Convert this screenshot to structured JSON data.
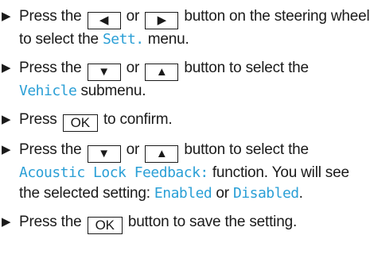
{
  "steps": [
    {
      "a": "Press the",
      "key1": "◀",
      "b": "or",
      "key2": "▶",
      "c": "button on the steering wheel to select the",
      "disp": "Sett.",
      "d": "menu."
    },
    {
      "a": "Press the",
      "key1": "▼",
      "b": "or",
      "key2": "▲",
      "c": "button to select the",
      "disp": "Vehicle",
      "d": "submenu."
    },
    {
      "a": "Press",
      "key": "OK",
      "b": "to confirm."
    },
    {
      "a": "Press the",
      "key1": "▼",
      "b": "or",
      "key2": "▲",
      "c": "button to select the",
      "disp": "Acoustic Lock Feedback:",
      "d": "function. You will see the selected setting:",
      "disp2": "Enabled",
      "e": "or",
      "disp3": "Disabled",
      "f": "."
    },
    {
      "a": "Press the",
      "key": "OK",
      "b": "button to save the setting."
    }
  ],
  "colors": {
    "display_text": "#2a9fd6",
    "body_text": "#1a1a1a"
  },
  "icons": {
    "bullet": "triangle-right-icon"
  }
}
